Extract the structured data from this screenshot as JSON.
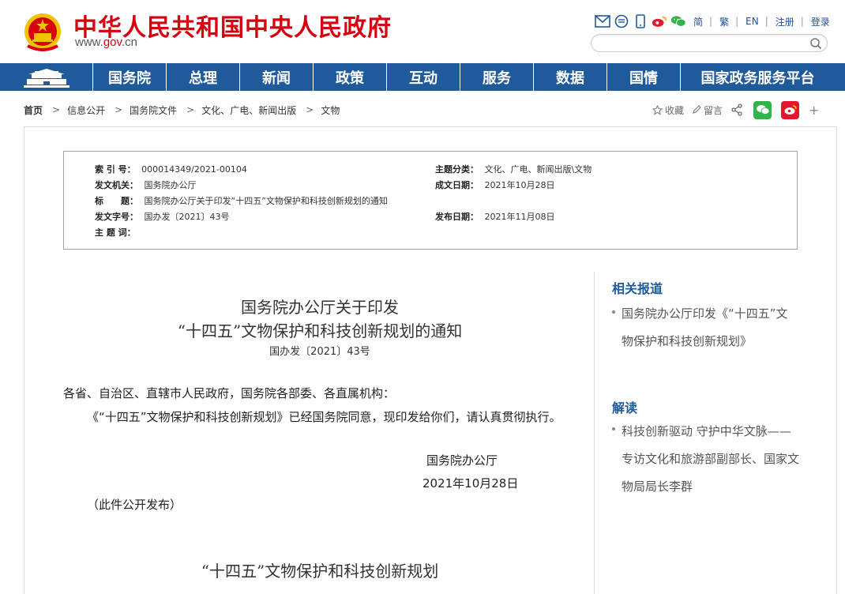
{
  "header": {
    "site_title": "中华人民共和国中央人民政府",
    "domain_prefix": "www.",
    "domain_brand": "gov",
    "domain_suffix": ".cn",
    "search": {
      "placeholder": ""
    },
    "tools": [
      {
        "icon": "mail-icon"
      },
      {
        "icon": "chat-bubble-icon"
      },
      {
        "icon": "mobile-icon"
      },
      {
        "icon": "weibo-icon"
      },
      {
        "icon": "wechat-icon"
      }
    ],
    "lang": [
      "简",
      "繁",
      "EN",
      "注册",
      "登录"
    ]
  },
  "nav": {
    "items": [
      "国务院",
      "总理",
      "新闻",
      "政策",
      "互动",
      "服务",
      "数据",
      "国情",
      "国家政务服务平台"
    ]
  },
  "breadcrumb": {
    "items": [
      "首页",
      "信息公开",
      "国务院文件",
      "文化、广电、新闻出版",
      "文物"
    ]
  },
  "share": {
    "favorite": "收藏",
    "comment": "留言",
    "plus": "+"
  },
  "meta": {
    "index_label": "索 引 号：",
    "index_value": "000014349/2021-00104",
    "category_label": "主题分类：",
    "category_value": "文化、广电、新闻出版\\文物",
    "issuer_label": "发文机关：",
    "issuer_value": "国务院办公厅",
    "created_label": "成文日期：",
    "created_value": "2021年10月28日",
    "title_label": "标　　题：",
    "title_value": "国务院办公厅关于印发“十四五”文物保护和科技创新规划的通知",
    "docnum_label": "发文字号：",
    "docnum_value": "国办发〔2021〕43号",
    "published_label": "发布日期：",
    "published_value": "2021年11月08日",
    "keywords_label": "主 题 词："
  },
  "article": {
    "title_line1": "国务院办公厅关于印发",
    "title_line2": "“十四五”文物保护和科技创新规划的通知",
    "doc_number": "国办发〔2021〕43号",
    "salutation": "各省、自治区、直辖市人民政府，国务院各部委、各直属机构：",
    "body": "《“十四五”文物保护和科技创新规划》已经国务院同意，现印发给你们，请认真贯彻执行。",
    "signer": "国务院办公厅",
    "date": "2021年10月28日",
    "note": "（此件公开发布）",
    "plan_title": "“十四五”文物保护和科技创新规划"
  },
  "sidebar": {
    "related_heading": "相关报道",
    "related_items": [
      "国务院办公厅印发《“十四五”文物保护和科技创新规划》"
    ],
    "interpret_heading": "解读",
    "interpret_items": [
      "科技创新驱动 守护中华文脉——专访文化和旅游部副部长、国家文物局局长李群"
    ]
  },
  "colors": {
    "brand_red": "#d7000f",
    "nav_blue": "#1f5a9b",
    "wechat_green": "#33b44a",
    "weibo_red": "#e6162d"
  }
}
